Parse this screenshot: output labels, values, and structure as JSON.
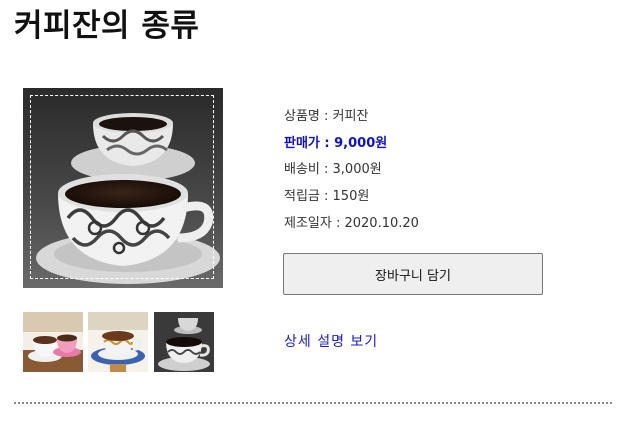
{
  "page": {
    "title": "커피잔의 종류"
  },
  "product": {
    "name_row": "상품명 : 커피잔",
    "price_row": "판매가 : 9,000원",
    "shipping_row": "배송비 : 3,000원",
    "points_row": "적립금 : 150원",
    "manufactured_row": "제조일자 : 2020.10.20"
  },
  "actions": {
    "cart_button_label": "장바구니 담기",
    "detail_link_label": "상세 설명 보기"
  },
  "images": {
    "main_image_alt": "cup-image",
    "thumbnails": [
      "cup-thumbnail-1",
      "cup-thumbnail-2",
      "cup-thumbnail-3"
    ]
  },
  "colors": {
    "price_text": "#1010c8",
    "link_text": "#1a1ad0",
    "button_background": "#efefef",
    "divider": "#888888"
  }
}
